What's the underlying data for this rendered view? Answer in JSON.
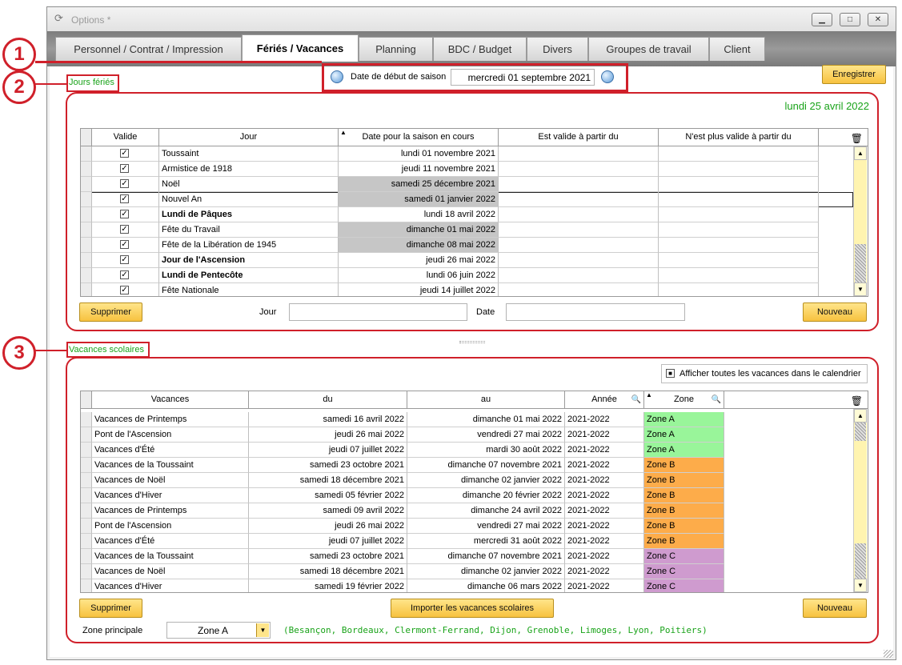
{
  "window": {
    "title": "Options *"
  },
  "tabs": [
    {
      "label": "Personnel / Contrat / Impression"
    },
    {
      "label": "Fériés / Vacances"
    },
    {
      "label": "Planning"
    },
    {
      "label": "BDC / Budget"
    },
    {
      "label": "Divers"
    },
    {
      "label": "Groupes de travail"
    },
    {
      "label": "Client"
    }
  ],
  "callouts": [
    "1",
    "2",
    "3"
  ],
  "season": {
    "label": "Date de début de saison",
    "value": "mercredi 01 septembre 2021"
  },
  "save_button": "Enregistrer",
  "holidays": {
    "section_label": "Jours fériés",
    "current_date": "lundi 25 avril 2022",
    "columns": [
      "Valide",
      "Jour",
      "Date pour la saison en cours",
      "Est valide à partir du",
      "N'est plus valide à partir du"
    ],
    "rows": [
      {
        "checked": "✓",
        "jour": "Toussaint",
        "date": "lundi 01 novembre 2021",
        "bold": false,
        "gray": false
      },
      {
        "checked": "✓",
        "jour": "Armistice de 1918",
        "date": "jeudi 11 novembre 2021",
        "bold": false,
        "gray": false
      },
      {
        "checked": "✓",
        "jour": "Noël",
        "date": "samedi 25 décembre 2021",
        "bold": false,
        "gray": true
      },
      {
        "checked": "✓",
        "jour": "Nouvel An",
        "date": "samedi 01 janvier 2022",
        "bold": false,
        "gray": true
      },
      {
        "checked": "✓",
        "jour": "Lundi de Pâques",
        "date": "lundi 18 avril 2022",
        "bold": true,
        "gray": false
      },
      {
        "checked": "✓",
        "jour": "Fête du Travail",
        "date": "dimanche 01 mai 2022",
        "bold": false,
        "gray": true
      },
      {
        "checked": "✓",
        "jour": "Fête de la Libération de 1945",
        "date": "dimanche 08 mai 2022",
        "bold": false,
        "gray": true
      },
      {
        "checked": "✓",
        "jour": "Jour de l'Ascension",
        "date": "jeudi 26 mai 2022",
        "bold": true,
        "gray": false
      },
      {
        "checked": "✓",
        "jour": "Lundi de Pentecôte",
        "date": "lundi 06 juin 2022",
        "bold": true,
        "gray": false
      },
      {
        "checked": "✓",
        "jour": "Fête Nationale",
        "date": "jeudi 14 juillet 2022",
        "bold": false,
        "gray": false
      }
    ],
    "delete_button": "Supprimer",
    "new_button": "Nouveau",
    "jour_label": "Jour",
    "jour_value": "",
    "date_label": "Date",
    "date_value": ""
  },
  "vacations": {
    "section_label": "Vacances scolaires",
    "show_all_checkbox": "Afficher toutes les vacances dans le calendrier",
    "show_all_checked": "■",
    "columns": [
      "Vacances",
      "du",
      "au",
      "Année",
      "Zone"
    ],
    "rows": [
      {
        "name": "Vacances de Printemps",
        "du": "samedi 16 avril 2022",
        "au": "dimanche 01 mai 2022",
        "annee": "2021-2022",
        "zone": "Zone A",
        "zclass": "zoneA"
      },
      {
        "name": "Pont de l'Ascension",
        "du": "jeudi 26 mai 2022",
        "au": "vendredi 27 mai 2022",
        "annee": "2021-2022",
        "zone": "Zone A",
        "zclass": "zoneA"
      },
      {
        "name": "Vacances d'Été",
        "du": "jeudi 07 juillet 2022",
        "au": "mardi 30 août 2022",
        "annee": "2021-2022",
        "zone": "Zone A",
        "zclass": "zoneA"
      },
      {
        "name": "Vacances de la Toussaint",
        "du": "samedi 23 octobre 2021",
        "au": "dimanche 07 novembre 2021",
        "annee": "2021-2022",
        "zone": "Zone B",
        "zclass": "zoneB"
      },
      {
        "name": "Vacances de Noël",
        "du": "samedi 18 décembre 2021",
        "au": "dimanche 02 janvier 2022",
        "annee": "2021-2022",
        "zone": "Zone B",
        "zclass": "zoneB"
      },
      {
        "name": "Vacances d'Hiver",
        "du": "samedi 05 février 2022",
        "au": "dimanche 20 février 2022",
        "annee": "2021-2022",
        "zone": "Zone B",
        "zclass": "zoneB"
      },
      {
        "name": "Vacances de Printemps",
        "du": "samedi 09 avril 2022",
        "au": "dimanche 24 avril 2022",
        "annee": "2021-2022",
        "zone": "Zone B",
        "zclass": "zoneB"
      },
      {
        "name": "Pont de l'Ascension",
        "du": "jeudi 26 mai 2022",
        "au": "vendredi 27 mai 2022",
        "annee": "2021-2022",
        "zone": "Zone B",
        "zclass": "zoneB"
      },
      {
        "name": "Vacances d'Été",
        "du": "jeudi 07 juillet 2022",
        "au": "mercredi 31 août 2022",
        "annee": "2021-2022",
        "zone": "Zone B",
        "zclass": "zoneB"
      },
      {
        "name": "Vacances de la Toussaint",
        "du": "samedi 23 octobre 2021",
        "au": "dimanche 07 novembre 2021",
        "annee": "2021-2022",
        "zone": "Zone C",
        "zclass": "zoneC"
      },
      {
        "name": "Vacances de Noël",
        "du": "samedi 18 décembre 2021",
        "au": "dimanche 02 janvier 2022",
        "annee": "2021-2022",
        "zone": "Zone C",
        "zclass": "zoneC"
      },
      {
        "name": "Vacances d'Hiver",
        "du": "samedi 19 février 2022",
        "au": "dimanche 06 mars 2022",
        "annee": "2021-2022",
        "zone": "Zone C",
        "zclass": "zoneC"
      }
    ],
    "delete_button": "Supprimer",
    "import_button": "Importer les vacances scolaires",
    "new_button": "Nouveau",
    "zone_label": "Zone principale",
    "zone_value": "Zone A",
    "zone_cities": "(Besançon, Bordeaux, Clermont-Ferrand, Dijon, Grenoble, Limoges, Lyon, Poitiers)"
  },
  "colors": {
    "annotation_red": "#d0202a",
    "label_green": "#19a319",
    "button_yellow": "#f7c23f",
    "zone_a": "#99f59a",
    "zone_b": "#fdac4a",
    "zone_c": "#cf9bcf"
  }
}
